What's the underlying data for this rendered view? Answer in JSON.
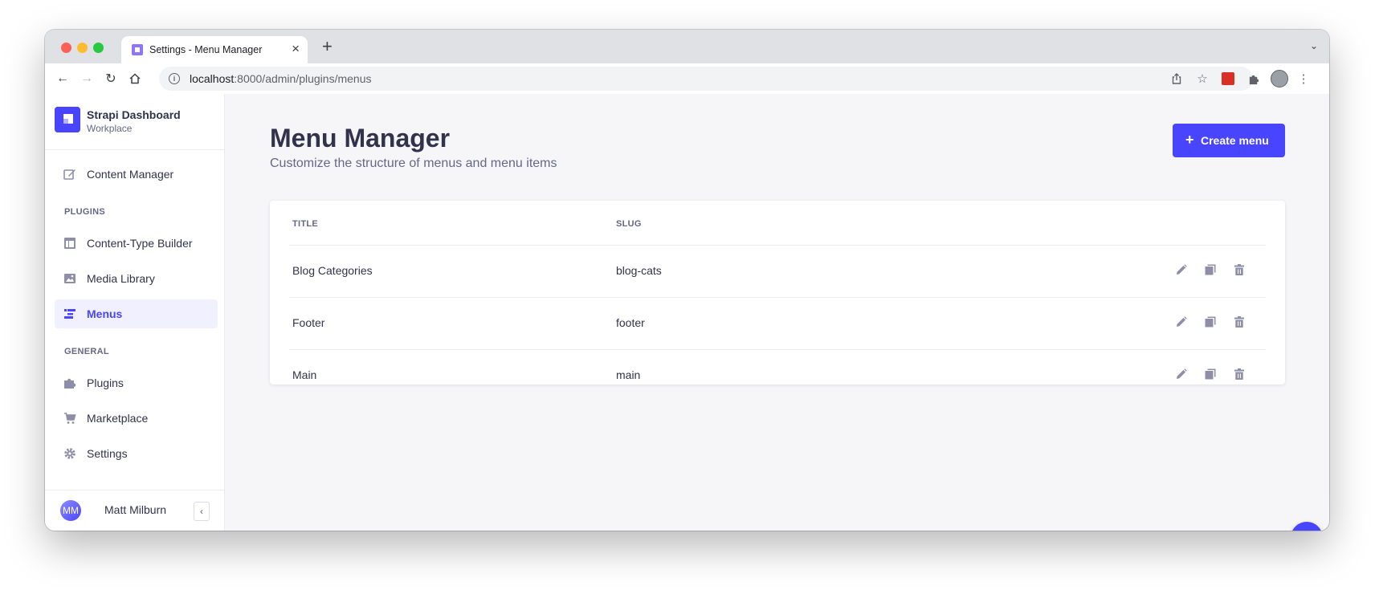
{
  "browser": {
    "tab_title": "Settings - Menu Manager",
    "new_tab_symbol": "+",
    "url_host": "localhost",
    "url_rest": ":8000/admin/plugins/menus"
  },
  "sidebar": {
    "brand_title": "Strapi Dashboard",
    "brand_subtitle": "Workplace",
    "items_top": [
      {
        "label": "Content Manager",
        "icon": "pencil-square-icon"
      }
    ],
    "plugins_header": "PLUGINS",
    "plugins": [
      {
        "label": "Content-Type Builder",
        "icon": "layout-icon"
      },
      {
        "label": "Media Library",
        "icon": "image-icon"
      },
      {
        "label": "Menus",
        "icon": "menu-icon",
        "active": true
      }
    ],
    "general_header": "GENERAL",
    "general": [
      {
        "label": "Plugins",
        "icon": "puzzle-icon"
      },
      {
        "label": "Marketplace",
        "icon": "cart-icon"
      },
      {
        "label": "Settings",
        "icon": "gear-icon"
      }
    ],
    "user": {
      "initials": "MM",
      "name": "Matt Milburn"
    }
  },
  "main": {
    "title": "Menu Manager",
    "subtitle": "Customize the structure of menus and menu items",
    "create_button": "Create menu",
    "table": {
      "headers": {
        "title": "TITLE",
        "slug": "SLUG"
      },
      "rows": [
        {
          "title": "Blog Categories",
          "slug": "blog-cats"
        },
        {
          "title": "Footer",
          "slug": "footer"
        },
        {
          "title": "Main",
          "slug": "main"
        }
      ]
    }
  },
  "help_button": "?",
  "colors": {
    "accent": "#4945ff",
    "text": "#32324d",
    "muted": "#666687"
  }
}
